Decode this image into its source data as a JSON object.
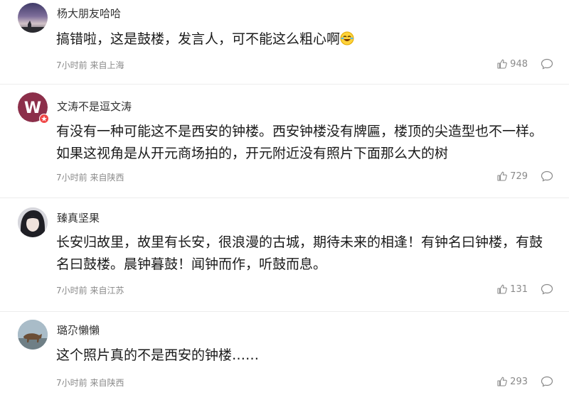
{
  "comments": [
    {
      "username": "杨大朋友哈哈",
      "text": "搞错啦，这是鼓楼，发言人，可不能这么粗心啊",
      "emoji_icon": "laughing-tears-emoji",
      "time": "7小时前",
      "location": "来自上海",
      "likes": "948"
    },
    {
      "username": "文涛不是逗文涛",
      "text": "有没有一种可能这不是西安的钟楼。西安钟楼没有牌匾，楼顶的尖造型也不一样。如果这视角是从开元商场拍的，开元附近没有照片下面那么大的树",
      "time": "7小时前",
      "location": "来自陕西",
      "likes": "729"
    },
    {
      "username": "臻真坚果",
      "text": "长安归故里，故里有长安，很浪漫的古城，期待未来的相逢！有钟名曰钟楼，有鼓名曰鼓楼。晨钟暮鼓！闻钟而作，听鼓而息。",
      "time": "7小时前",
      "location": "来自江苏",
      "likes": "131"
    },
    {
      "username": "璐尕懶懶",
      "text": "这个照片真的不是西安的钟楼……",
      "time": "7小时前",
      "location": "来自陕西",
      "likes": "293"
    }
  ],
  "colors": {
    "text": "#1a1a1a",
    "meta": "#8a8a8a",
    "divider": "#ededed",
    "verified_badge": "#f04545"
  }
}
